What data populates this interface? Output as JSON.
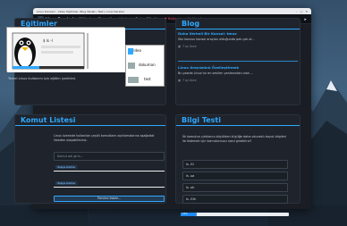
{
  "window": {
    "title": "Linux Dersleri - Video Eğitimler, Blog Yazıları, Test | Linux Dersleri",
    "controls": [
      "–",
      "□",
      "✕"
    ]
  },
  "navbar": {
    "brand": "Linux Dersleri",
    "links": [
      "Eğitimler",
      "Blog",
      "Komut Listesi",
      "Test",
      "Etiketler",
      "❤ Bağışçılar",
      "Hakkında"
    ],
    "icons": [
      "search-icon",
      "theme-toggle-icon",
      "send-icon"
    ]
  },
  "education": {
    "title": "Eğitimler",
    "desc": "Temel Linux kullanımı için eğitim içerikleri.",
    "video_labels": [
      "video",
      "dokuman",
      "test"
    ]
  },
  "blog": {
    "title": "Blog",
    "posts": [
      {
        "title": "Daha Verimli Bir Konsol: tmux",
        "summary": "Söz konusu konsol araçları olduğunda pek çok al...",
        "date": "7 ay önce"
      },
      {
        "title": "Linux Arayüzünü Özelleştirmek",
        "summary": "Bu yazıda Linux'un en sevilen yanlarından olan ...",
        "date": "7 ay önce"
      }
    ]
  },
  "commands": {
    "title": "Komut Listesi",
    "desc": "Linux üzerinde kullanılan çeşitli komutların açıklamalarına aşağıdaki listeden ulaşabilirsiniz.",
    "search_placeholder": "Komut adı girin...",
    "rows": [
      "dosya arama",
      "dosya arama"
    ],
    "show_all": "Tümünü listele..."
  },
  "quiz": {
    "title": "Bilgi Testi",
    "question": "İlk komutun çıktılarını büyükten küçüğe daha okunaklı boyut bilgileri ile listemek için komutumuzu nasıl girebiliriz?",
    "options": [
      "ls -Sl",
      "ls -sa",
      "ls -sh",
      "ls -Slh"
    ],
    "progress": 0.15,
    "progress_label": "15%"
  },
  "colors": {
    "accent": "#2fa8ff",
    "background": "#1b1f26"
  }
}
